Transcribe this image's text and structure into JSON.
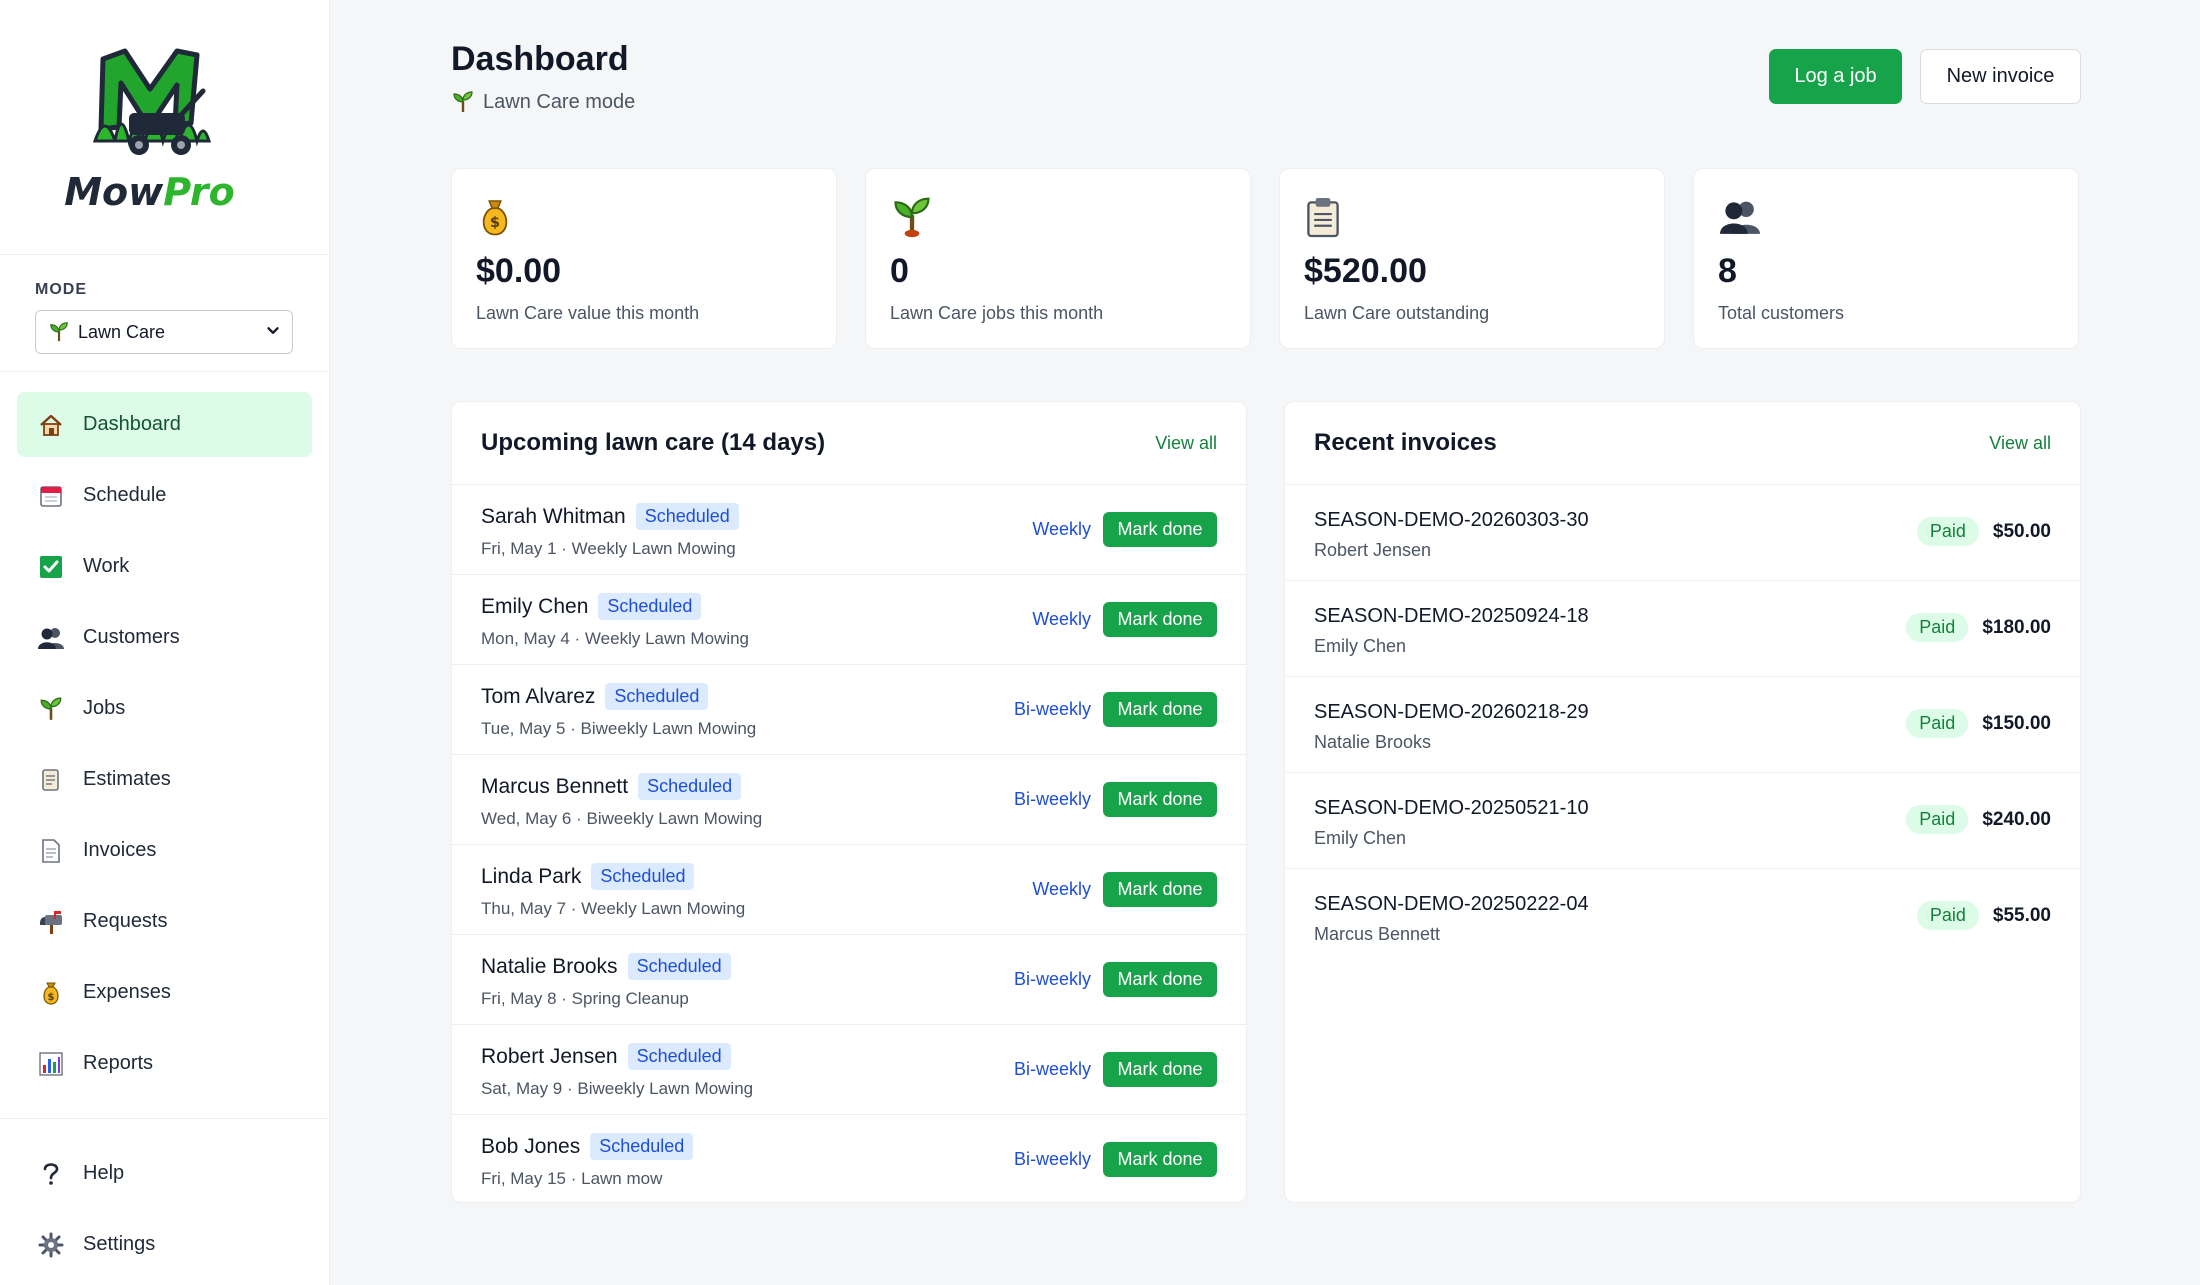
{
  "brand": {
    "name_part1": "Mow",
    "name_part2": "Pro"
  },
  "mode": {
    "label": "MODE",
    "selected": "Lawn Care"
  },
  "nav": [
    {
      "label": "Dashboard",
      "icon": "house-icon",
      "active": true
    },
    {
      "label": "Schedule",
      "icon": "calendar-icon"
    },
    {
      "label": "Work",
      "icon": "checkbox-icon"
    },
    {
      "label": "Customers",
      "icon": "users-icon"
    },
    {
      "label": "Jobs",
      "icon": "sprout-icon"
    },
    {
      "label": "Estimates",
      "icon": "scroll-icon"
    },
    {
      "label": "Invoices",
      "icon": "document-icon"
    },
    {
      "label": "Requests",
      "icon": "mailbox-icon"
    },
    {
      "label": "Expenses",
      "icon": "money-bag-icon"
    },
    {
      "label": "Reports",
      "icon": "bar-chart-icon"
    }
  ],
  "nav_bottom": [
    {
      "label": "Help",
      "icon": "question-icon"
    },
    {
      "label": "Settings",
      "icon": "gear-icon"
    }
  ],
  "header": {
    "title": "Dashboard",
    "subtitle": "Lawn Care mode",
    "log_job": "Log a job",
    "new_invoice": "New invoice"
  },
  "stats": [
    {
      "value": "$0.00",
      "label": "Lawn Care value this month",
      "icon": "money-bag-icon"
    },
    {
      "value": "0",
      "label": "Lawn Care jobs this month",
      "icon": "sprout-icon"
    },
    {
      "value": "$520.00",
      "label": "Lawn Care outstanding",
      "icon": "clipboard-icon"
    },
    {
      "value": "8",
      "label": "Total customers",
      "icon": "users-icon"
    }
  ],
  "upcoming": {
    "title": "Upcoming lawn care (14 days)",
    "view_all": "View all",
    "status_label": "Scheduled",
    "action_label": "Mark done",
    "rows": [
      {
        "name": "Sarah Whitman",
        "meta": "Fri, May 1 · Weekly Lawn Mowing",
        "freq": "Weekly"
      },
      {
        "name": "Emily Chen",
        "meta": "Mon, May 4 · Weekly Lawn Mowing",
        "freq": "Weekly"
      },
      {
        "name": "Tom Alvarez",
        "meta": "Tue, May 5 · Biweekly Lawn Mowing",
        "freq": "Bi-weekly"
      },
      {
        "name": "Marcus Bennett",
        "meta": "Wed, May 6 · Biweekly Lawn Mowing",
        "freq": "Bi-weekly"
      },
      {
        "name": "Linda Park",
        "meta": "Thu, May 7 · Weekly Lawn Mowing",
        "freq": "Weekly"
      },
      {
        "name": "Natalie Brooks",
        "meta": "Fri, May 8 · Spring Cleanup",
        "freq": "Bi-weekly"
      },
      {
        "name": "Robert Jensen",
        "meta": "Sat, May 9 · Biweekly Lawn Mowing",
        "freq": "Bi-weekly"
      },
      {
        "name": "Bob Jones",
        "meta": "Fri, May 15 · Lawn mow",
        "freq": "Bi-weekly"
      }
    ]
  },
  "invoices": {
    "title": "Recent invoices",
    "view_all": "View all",
    "status_label": "Paid",
    "rows": [
      {
        "number": "SEASON-DEMO-20260303-30",
        "customer": "Robert Jensen",
        "amount": "$50.00"
      },
      {
        "number": "SEASON-DEMO-20250924-18",
        "customer": "Emily Chen",
        "amount": "$180.00"
      },
      {
        "number": "SEASON-DEMO-20260218-29",
        "customer": "Natalie Brooks",
        "amount": "$150.00"
      },
      {
        "number": "SEASON-DEMO-20250521-10",
        "customer": "Emily Chen",
        "amount": "$240.00"
      },
      {
        "number": "SEASON-DEMO-20250222-04",
        "customer": "Marcus Bennett",
        "amount": "$55.00"
      }
    ]
  },
  "colors": {
    "accent": "#16a34a",
    "active_bg": "#dcfce7",
    "link_blue": "#1d4ed8"
  }
}
